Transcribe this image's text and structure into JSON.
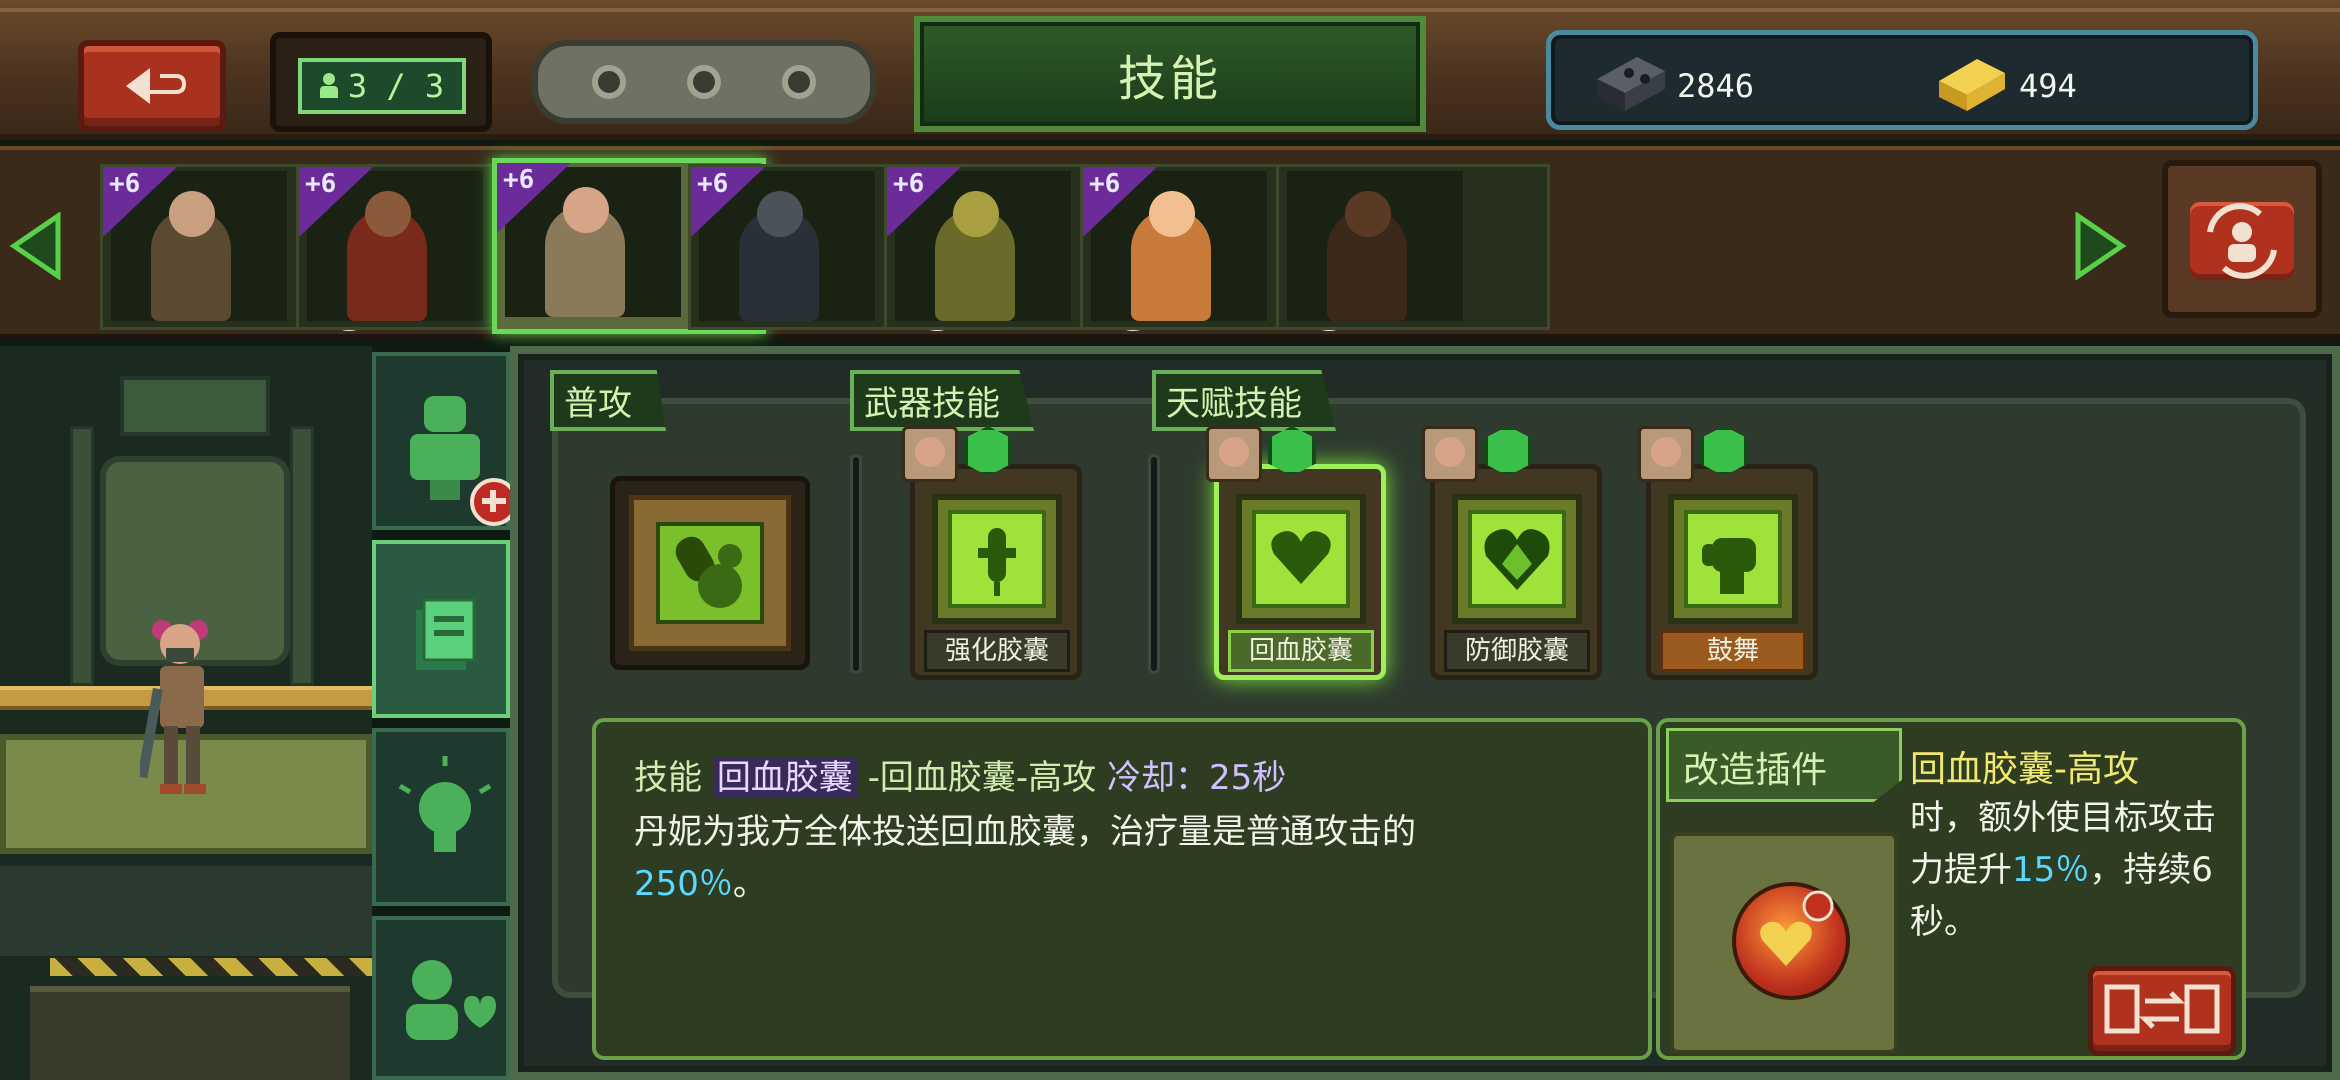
{
  "header": {
    "title": "技能",
    "team_count": "3 / 3",
    "currency": {
      "parts": "2846",
      "gold": "494"
    }
  },
  "characters": [
    {
      "level": "+6",
      "role": "green",
      "selected": false,
      "colors": [
        "#5a4a32",
        "#c8a080"
      ]
    },
    {
      "level": "+6",
      "role": "green",
      "selected": false,
      "colors": [
        "#7a2a1a",
        "#8a5a3a"
      ]
    },
    {
      "level": "+6",
      "role": "green",
      "selected": true,
      "colors": [
        "#8a7a5a",
        "#d8a488"
      ]
    },
    {
      "level": "+6",
      "role": "orange",
      "selected": false,
      "colors": [
        "#2a3038",
        "#4a525a"
      ]
    },
    {
      "level": "+6",
      "role": "orange",
      "selected": false,
      "colors": [
        "#6a6a2a",
        "#a8a040"
      ]
    },
    {
      "level": "+6",
      "role": "orange",
      "selected": false,
      "colors": [
        "#c87a3a",
        "#f2c090"
      ]
    },
    {
      "level": "",
      "role": "",
      "selected": false,
      "colors": [
        "#3a2818",
        "#5a3a24"
      ]
    }
  ],
  "sections": {
    "basic": "普攻",
    "weapon": "武器技能",
    "talent": "天赋技能"
  },
  "skills": {
    "weapon": {
      "name": "强化胶囊"
    },
    "talent": [
      {
        "name": "回血胶囊",
        "selected": true
      },
      {
        "name": "防御胶囊",
        "selected": false
      },
      {
        "name": "鼓舞",
        "selected": false
      }
    ]
  },
  "description": {
    "prefix": "技能",
    "skill_name": "回血胶囊",
    "variant": "-回血胶囊-高攻",
    "cooldown": "冷却：25秒",
    "text_a": "丹妮为我方全体投送回血胶囊，治疗量是普通攻击的",
    "value": "250％",
    "text_b": "。"
  },
  "plugin": {
    "label": "改造插件",
    "title": "回血胶囊-高攻",
    "text_a": "时，额外使目标攻击力提升",
    "value": "15％",
    "text_b": "，持续6秒。"
  },
  "icons": {
    "back": "back-arrow-icon",
    "switch": "switch-character-icon",
    "swap": "swap-plugin-icon"
  }
}
